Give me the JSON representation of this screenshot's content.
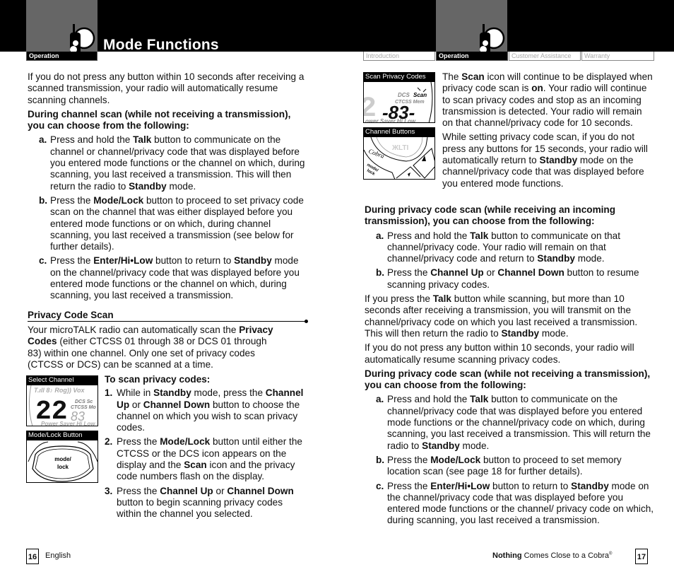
{
  "header": {
    "title": "Mode Functions",
    "left_tab": "Operation",
    "nav_tabs": [
      "Introduction",
      "Operation",
      "Customer Assistance",
      "Warranty"
    ],
    "active_tab": "Operation",
    "section_icon": "walkie-talkie-icon"
  },
  "left_page": {
    "intro": "If you do not press any button within 10 seconds after receiving a scanned transmission, your radio will automatically resume scanning channels.",
    "channel_scan_heading": "During channel scan (while not receiving a transmission), you can choose from the following:",
    "channel_scan_items": [
      {
        "label": "a.",
        "html": "Press and hold the <b>Talk</b> button to communicate on the channel or channel/privacy code that was displayed before you entered mode functions or the channel on which, during scanning, you last received a transmission. This will then return the radio to <b>Standby</b> mode."
      },
      {
        "label": "b.",
        "html": "Press the <b>Mode/Lock</b> button to proceed to set privacy code scan on the channel that was either displayed before you entered mode functions or on which, during channel scanning, you last received a transmission (see below for further details)."
      },
      {
        "label": "c.",
        "html": "Press the <b>Enter/Hi•Low</b> button to return to <b>Standby</b> mode on the channel/privacy code that was displayed before you entered mode functions or the channel on which, during scanning, you last received a transmission."
      }
    ],
    "section_title": "Privacy Code Scan",
    "section_intro_html": "Your microTALK radio can automatically scan the <b>Privacy Codes</b> (either CTCSS 01 through 38 or DCS 01 through 83) within one channel. Only one set of privacy codes (CTCSS or DCS) can be scanned at a time.",
    "steps_heading": "To scan privacy codes:",
    "steps": [
      {
        "label": "1.",
        "html": "While in <b>Standby</b> mode, press the <b>Channel Up</b> or <b>Channel Down</b> button to choose the channel on which you wish to scan privacy codes."
      },
      {
        "label": "2.",
        "html": "Press the <b>Mode/Lock</b> button until either the CTCSS or the DCS icon appears on the display and the <b>Scan</b> icon and the privacy code numbers flash on the display."
      },
      {
        "label": "3.",
        "html": "Press the <b>Channel Up</b> or <b>Channel Down</b> button to begin scanning privacy codes within the channel you selected."
      }
    ],
    "figures": [
      {
        "label": "Select Channel",
        "channel": "22",
        "code": "83",
        "indicators": [
          "DCS",
          "CTCSS",
          "Power Saver",
          "Hi Low",
          "Vox"
        ]
      },
      {
        "label": "Mode/Lock Button",
        "button_text": [
          "mode/",
          "lock"
        ]
      }
    ],
    "page_number": "16",
    "footer_text": "English"
  },
  "right_page": {
    "figures": [
      {
        "label": "Scan Privacy Codes",
        "code": "-83-",
        "indicators": [
          "DCS",
          "Scan",
          "CTCSS",
          "Power Saver",
          "Hi Low"
        ]
      },
      {
        "label": "Channel Buttons",
        "brand": "Cobra",
        "button_text": [
          "mode/",
          "lock"
        ]
      }
    ],
    "para1_html": "The <b>Scan</b> icon will continue to be displayed when privacy code scan is <b>on</b>. Your radio will continue to scan privacy codes and stop as an incoming transmission is detected. Your radio will remain on that channel/privacy code for 10 seconds.",
    "para2_html": "While setting privacy code scan, if you do not press any buttons for 15 seconds, your radio will automatically return to <b>Standby</b> mode on the channel/privacy code that was displayed before you entered mode functions.",
    "receiving_heading": "During privacy code scan (while receiving an incoming transmission), you can choose from the following:",
    "receiving_items": [
      {
        "label": "a.",
        "html": "Press and hold the <b>Talk</b> button to communicate on that channel/privacy code. Your radio will remain on that channel/privacy code and return to <b>Standby</b> mode."
      },
      {
        "label": "b.",
        "html": "Press the <b>Channel Up</b> or <b>Channel Down</b> button to resume scanning privacy codes."
      }
    ],
    "para3_html": "If you press the <b>Talk</b> button while scanning, but more than 10 seconds after receiving a transmission, you will transmit on the channel/privacy code on which you last received a transmission. This will then return the radio to <b>Standby</b> mode.",
    "para4": "If you do not press any button within 10 seconds, your radio will automatically resume scanning privacy codes.",
    "not_receiving_heading": "During privacy code scan (while not receiving a transmission), you can choose from the following:",
    "not_receiving_items": [
      {
        "label": "a.",
        "html": "Press and hold the <b>Talk</b> button to communicate on the channel/privacy code that was displayed before you entered mode functions or the channel/privacy code on which, during scanning, you last received a transmission. This will return the radio to <b>Standby</b> mode."
      },
      {
        "label": "b.",
        "html": "Press the <b>Mode/Lock</b> button to proceed to set memory location scan (see page 18 for further details)."
      },
      {
        "label": "c.",
        "html": "Press the <b>Enter/Hi•Low</b> button to return to <b>Standby</b> mode on the channel/privacy code that was displayed before you entered mode functions or the channel/ privacy code on which, during scanning, you last received a transmission."
      }
    ],
    "page_number": "17",
    "footer_bold": "Nothing",
    "footer_text": " Comes Close to a Cobra",
    "footer_mark": "®"
  }
}
